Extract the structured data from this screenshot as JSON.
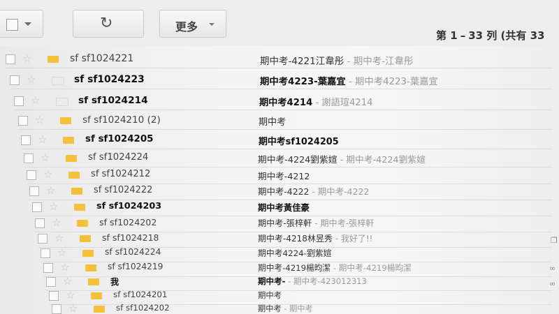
{
  "toolbar": {
    "refresh_icon": "refresh-icon",
    "more_label": "更多",
    "pagination": {
      "prefix": "第",
      "start": "1",
      "sep": "–",
      "end": "33",
      "suffix": "列 (共有",
      "total": "33"
    }
  },
  "emails": [
    {
      "sender": "sf sf1024221",
      "subject": "期中考-4221江韋彤",
      "snippet": " - 期中考-江韋彤",
      "unread": false
    },
    {
      "sender": "sf sf1024223",
      "subject": "期中考4223-葉嘉宜",
      "snippet": " - 期中考4223-葉嘉宜",
      "unread": true
    },
    {
      "sender": "sf sf1024214",
      "subject": "期中考4214",
      "snippet": " - 謝語瑄4214",
      "unread": true
    },
    {
      "sender": "sf sf1024210 (2)",
      "subject": "期中考",
      "snippet": "",
      "unread": false
    },
    {
      "sender": "sf sf1024205",
      "subject": "期中考sf1024205",
      "snippet": "",
      "unread": true
    },
    {
      "sender": "sf sf1024224",
      "subject": "期中考-4224劉紫媗",
      "snippet": " - 期中考-4224劉紫媗",
      "unread": false
    },
    {
      "sender": "sf sf1024212",
      "subject": "期中考-4212",
      "snippet": "",
      "unread": false
    },
    {
      "sender": "sf sf1024222",
      "subject": "期中考-4222",
      "snippet": " - 期中考-4222",
      "unread": false
    },
    {
      "sender": "sf sf1024203",
      "subject": "期中考黃佳豪",
      "snippet": "",
      "unread": true
    },
    {
      "sender": "sf sf1024202",
      "subject": "期中考-張梓軒",
      "snippet": " - 期中考-張梓軒",
      "unread": false
    },
    {
      "sender": "sf sf1024218",
      "subject": "期中考-4218林昱秀",
      "snippet": " - 我好了!!",
      "unread": false
    },
    {
      "sender": "sf sf1024224",
      "subject": "期中考4224-劉紫媗",
      "snippet": "",
      "unread": false
    },
    {
      "sender": "sf sf1024219",
      "subject": "期中考-4219楊昀潔",
      "snippet": " - 期中考-4219楊昀潔",
      "unread": false
    },
    {
      "sender": "我",
      "subject": "期中考-",
      "snippet": " - 期中考-423012313",
      "unread": true
    },
    {
      "sender": "sf sf1024201",
      "subject": "期中考",
      "snippet": "",
      "unread": false
    },
    {
      "sender": "sf sf1024202",
      "subject": "期中考",
      "snippet": " - 期中考",
      "unread": false
    }
  ]
}
